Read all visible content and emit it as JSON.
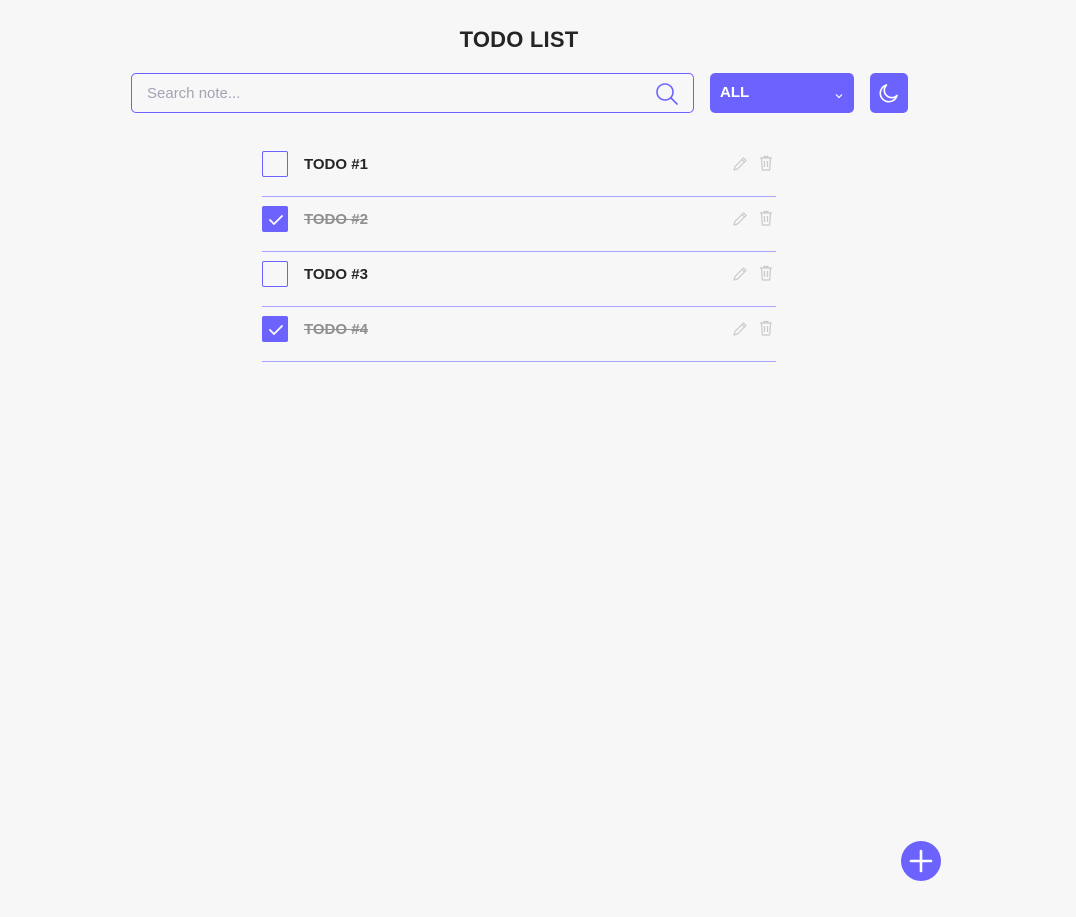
{
  "header": {
    "title": "TODO LIST"
  },
  "search": {
    "placeholder": "Search note...",
    "value": ""
  },
  "filter": {
    "selected": "ALL"
  },
  "todos": [
    {
      "label": "TODO #1",
      "done": false
    },
    {
      "label": "TODO #2",
      "done": true
    },
    {
      "label": "TODO #3",
      "done": false
    },
    {
      "label": "TODO #4",
      "done": true
    }
  ],
  "icons": {
    "search": "search-icon",
    "chevron": "chevron-down-icon",
    "theme": "moon-icon",
    "edit": "pencil-icon",
    "delete": "trash-icon",
    "check": "check-icon",
    "add": "plus-icon"
  },
  "colors": {
    "accent": "#6c63ff",
    "background": "#f7f7f7",
    "text": "#252525",
    "done_text": "#8f8f8f",
    "divider": "#a8a4ff",
    "action_icon": "#c9c9c9"
  }
}
